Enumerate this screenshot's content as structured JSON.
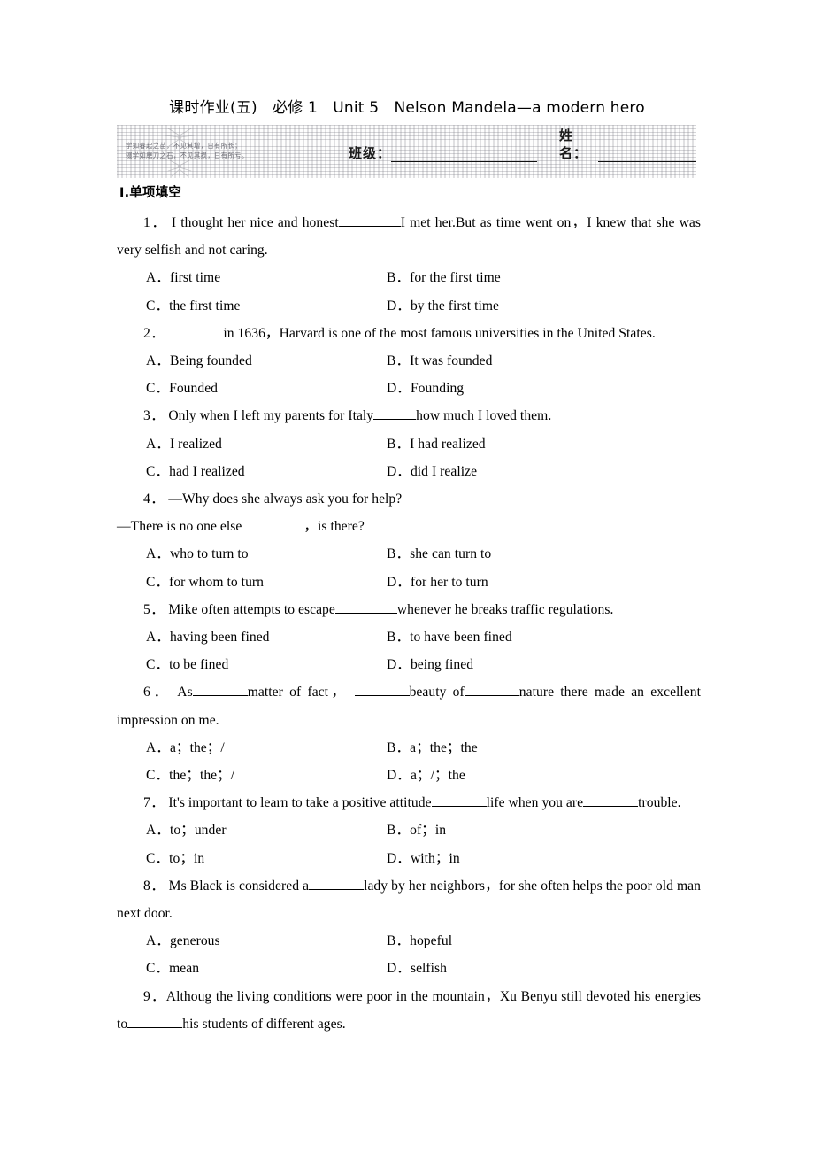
{
  "title": {
    "cn_label": "课时作业(五)",
    "book": "必修 1",
    "unit": "Unit 5",
    "topic": "Nelson Mandela—a modern hero",
    "full": "课时作业(五)　必修 1　Unit 5　Nelson Mandela—a modern hero"
  },
  "banner": {
    "proverb_line1": "学如春起之苗，不见其增，日有所长；",
    "proverb_line2": "辍学如磨刀之石，不见其损，日有所亏。",
    "class_label": "班级：",
    "name_label": "姓名："
  },
  "section": {
    "heading": "Ⅰ.单项填空"
  },
  "questions": [
    {
      "number": "1．",
      "stem_before": "I thought her nice and honest",
      "stem_after": "I met her.But as time went on，I knew that she was very selfish and not caring.",
      "options": [
        "A．first time",
        "B．for the first time",
        "C．the first time",
        "D．by the first time"
      ]
    },
    {
      "number": "2．",
      "stem_before": "",
      "stem_after": "in 1636，Harvard is one of the most famous universities in the United States.",
      "options": [
        "A．Being founded",
        "B．It was founded",
        "C．Founded",
        "D．Founding"
      ]
    },
    {
      "number": "3．",
      "stem_before": "Only when I left my parents for Italy",
      "stem_after": "how much I loved them.",
      "options": [
        "A．I realized",
        "B．I had realized",
        "C．had I realized",
        "D．did I realize"
      ]
    },
    {
      "number": "4．",
      "stem_before": "—Why does she always ask you for help?",
      "stem_line2_before": "—There is no one else",
      "stem_line2_after": "，is there?",
      "stem_after": "",
      "options": [
        "A．who to turn to",
        "B．she can turn to",
        "C．for whom to turn",
        "D．for her to turn"
      ]
    },
    {
      "number": "5．",
      "stem_before": "Mike often attempts to escape",
      "stem_after": "whenever he breaks traffic regulations.",
      "options": [
        "A．having been fined",
        "B．to have been fined",
        "C．to be fined",
        "D．being fined"
      ]
    },
    {
      "number": "6．",
      "stem_before": "As",
      "stem_mid1": "matter of fact，",
      "stem_mid2": "beauty of",
      "stem_after": "nature there made an excellent impression on me.",
      "options": [
        "A．a；the；/",
        "B．a；the；the",
        "C．the；the；/",
        "D．a；/；the"
      ]
    },
    {
      "number": "7．",
      "stem_before": "It's important to learn to take a positive attitude",
      "stem_mid1": "life when you are",
      "stem_after": "trouble.",
      "options": [
        "A．to；under",
        "B．of；in",
        "C．to；in",
        "D．with；in"
      ]
    },
    {
      "number": "8．",
      "stem_before": "Ms Black is considered a",
      "stem_after": "lady by her neighbors，for she often helps the poor old man next door.",
      "options": [
        "A．generous",
        "B．hopeful",
        "C．mean",
        "D．selfish"
      ]
    },
    {
      "number": "9．",
      "stem_before": "Althoug the living conditions were poor in the mountain，Xu Benyu still devoted his energies to",
      "stem_after": "his students of different ages.",
      "options": []
    }
  ],
  "colors": {
    "text": "#000000",
    "banner_texture": "#78787e",
    "proverb_text": "#6a6a72"
  }
}
